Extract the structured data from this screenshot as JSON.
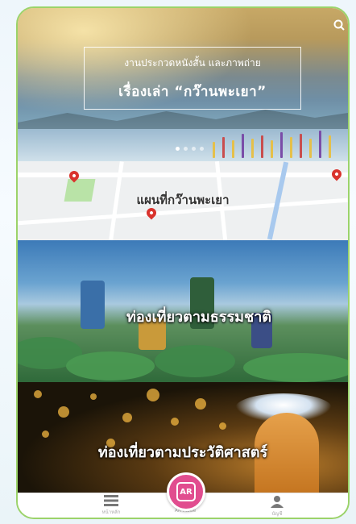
{
  "hero": {
    "subtitle": "งานประกวดหนังสั้น และภาพถ่าย",
    "title": "เรื่องเล่า “กว๊านพะเยา”",
    "search_icon": "search-icon"
  },
  "map": {
    "label": "แผนที่กว๊านพะเยา"
  },
  "tiles": [
    {
      "label": "ท่องเที่ยวตามธรรมชาติ"
    },
    {
      "label": "ท่องเที่ยวตามประวัติศาสตร์"
    }
  ],
  "nav": {
    "items": [
      {
        "icon": "menu-icon",
        "label": "หน้าหลัก"
      },
      {
        "icon": "ar-icon",
        "label": "AR Mode",
        "text": "AR"
      },
      {
        "icon": "user-icon",
        "label": "บัญชี"
      }
    ]
  },
  "colors": {
    "accent": "#e14d8f",
    "frame": "#9bd36a"
  }
}
